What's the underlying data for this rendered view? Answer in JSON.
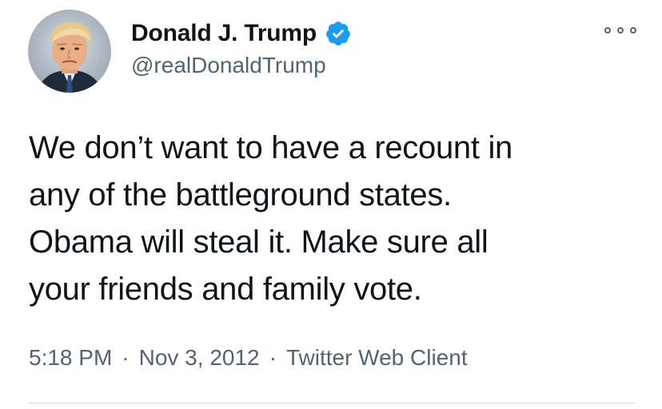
{
  "author": {
    "display_name": "Donald J. Trump",
    "handle": "@realDonaldTrump",
    "verified": true,
    "avatar_icon": "profile-photo",
    "verified_icon": "verified-badge-icon"
  },
  "tweet": {
    "lines": [
      "We don’t want to have a recount in",
      "any of the battleground states.",
      "Obama will steal it. Make sure all",
      "your friends and family vote."
    ],
    "time": "5:18 PM",
    "date": "Nov 3, 2012",
    "source": "Twitter Web Client",
    "separator": "·"
  },
  "menu": {
    "icon": "more-options-icon"
  },
  "colors": {
    "text": "#0f1419",
    "secondary": "#536471",
    "verified": "#1d9bf0",
    "divider": "#cfd9de"
  }
}
